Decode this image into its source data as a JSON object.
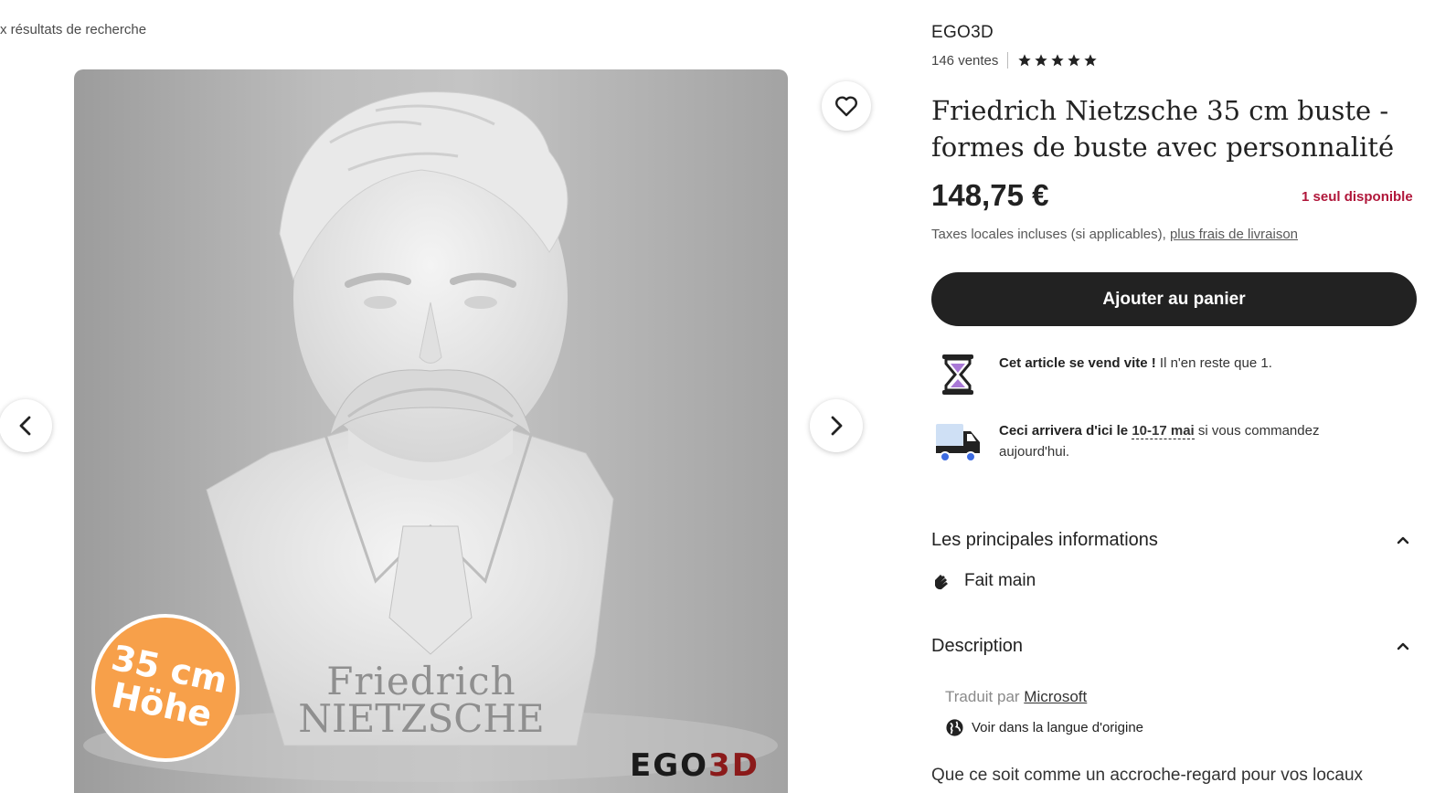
{
  "nav": {
    "back_label": "x résultats de recherche"
  },
  "gallery": {
    "bust_first_name": "Friedrich",
    "bust_last_name": "NIETZSCHE",
    "badge_line1": "35 cm",
    "badge_line2": "Höhe",
    "logo_part1": "EGO",
    "logo_part2": "3D"
  },
  "shop": {
    "name": "EGO3D",
    "sales": "146 ventes",
    "rating": 5
  },
  "product": {
    "title": "Friedrich Nietzsche 35 cm buste - formes de buste avec personnalité",
    "price": "148,75 €",
    "stock": "1 seul disponible",
    "tax_text": "Taxes locales incluses (si applicables), ",
    "shipping_link": "plus frais de livraison",
    "add_to_cart": "Ajouter au panier"
  },
  "highlights": {
    "selling_bold": "Cet article se vend vite !",
    "selling_rest": " Il n'en reste que 1.",
    "delivery_bold": "Ceci arrivera d'ici le ",
    "delivery_date": "10-17 mai",
    "delivery_rest": " si vous commandez aujourd'hui."
  },
  "sections": {
    "main_info_title": "Les principales informations",
    "handmade": "Fait main",
    "description_title": "Description",
    "translated_by": "Traduit par ",
    "translator": "Microsoft",
    "original_language": "Voir dans la langue d'origine",
    "description_start": "Que ce soit comme un accroche-regard pour vos locaux"
  },
  "colors": {
    "accent_dark": "#222222",
    "stock_red": "#b0163a",
    "badge_orange": "#f7a04a"
  }
}
